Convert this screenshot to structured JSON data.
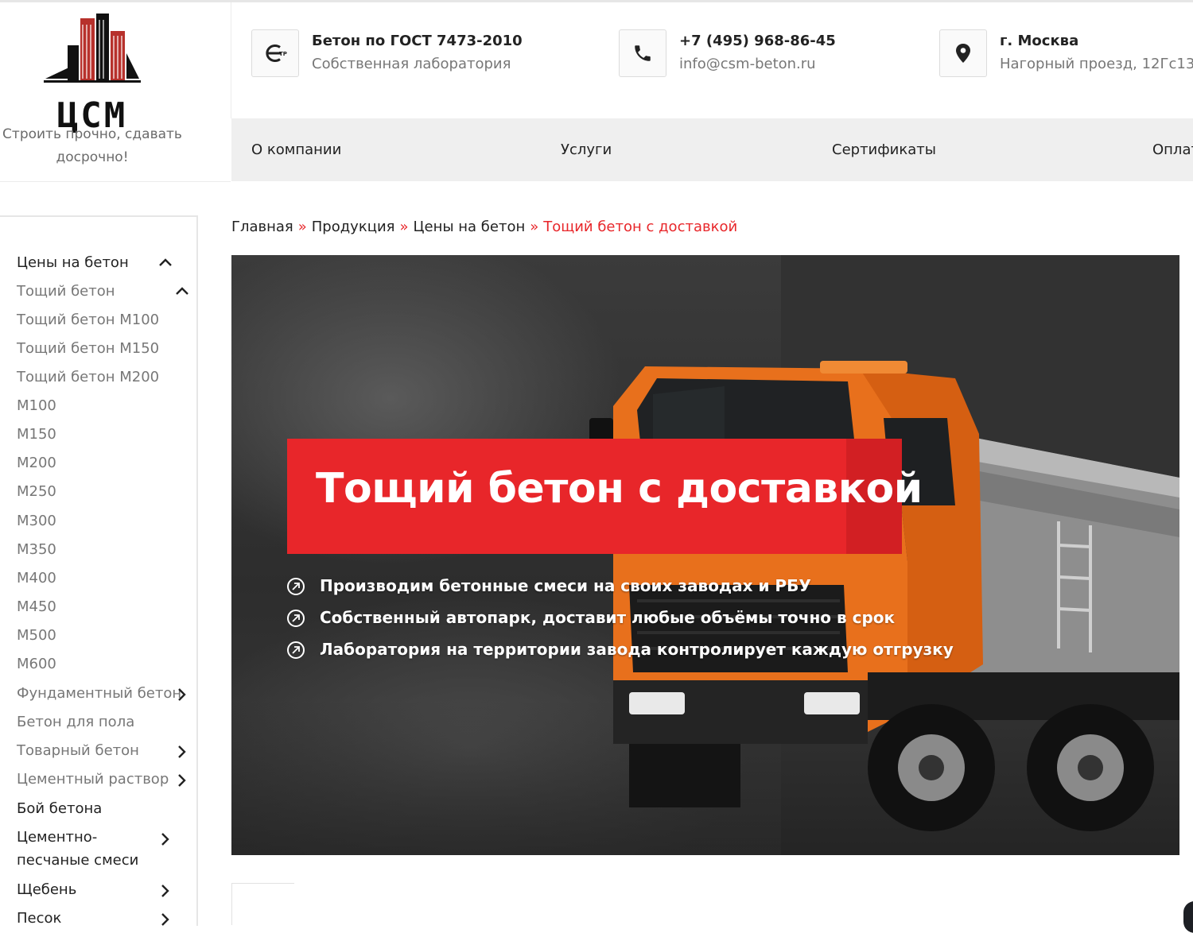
{
  "logo": {
    "text": "ЦСМ",
    "slogan_line1": "Строить прочно, сдавать",
    "slogan_line2": "досрочно!"
  },
  "header": {
    "info": [
      {
        "icon": "gost-certification-icon",
        "title": "Бетон по ГОСТ 7473-2010",
        "subtitle": "Собственная лаборатория"
      },
      {
        "icon": "phone-icon",
        "title": "+7 (495) 968-86-45",
        "subtitle": "info@csm-beton.ru"
      },
      {
        "icon": "location-pin-icon",
        "title": "г. Москва",
        "subtitle": "Нагорный проезд, 12Гс13"
      }
    ]
  },
  "nav": {
    "items": [
      "О компании",
      "Услуги",
      "Сертификаты",
      "Оплат"
    ]
  },
  "breadcrumb": {
    "items": [
      "Главная",
      "Продукция",
      "Цены на бетон"
    ],
    "separator": "»",
    "current": "Тощий бетон с доставкой"
  },
  "sidebar": {
    "items": [
      {
        "label": "Цены на бетон",
        "chevron": "up"
      },
      {
        "label": "Тощий бетон",
        "chevron": "up"
      },
      {
        "label": "Тощий бетон М100"
      },
      {
        "label": "Тощий бетон М150"
      },
      {
        "label": "Тощий бетон М200"
      },
      {
        "label": "М100"
      },
      {
        "label": "М150"
      },
      {
        "label": "М200"
      },
      {
        "label": "М250"
      },
      {
        "label": "М300"
      },
      {
        "label": "М350"
      },
      {
        "label": "М400"
      },
      {
        "label": "М450"
      },
      {
        "label": "М500"
      },
      {
        "label": "М600"
      },
      {
        "label": "Фундаментный бетон",
        "chevron": "right"
      },
      {
        "label": "Бетон для пола"
      },
      {
        "label": "Товарный бетон",
        "chevron": "right"
      },
      {
        "label": "Цементный раствор",
        "chevron": "right"
      },
      {
        "label": "Бой бетона"
      },
      {
        "label_line1": "Цементно-",
        "label_line2": "песчаные смеси",
        "chevron": "right"
      },
      {
        "label": "Щебень",
        "chevron": "right"
      },
      {
        "label": "Песок",
        "chevron": "right"
      }
    ]
  },
  "hero": {
    "title": "Тощий бетон с доставкой",
    "bullets": [
      "Производим бетонные смеси на своих заводах и РБУ",
      "Собственный автопарк, доставит любые объёмы точно в срок",
      "Лаборатория на территории завода контролирует каждую отгрузку"
    ]
  },
  "colors": {
    "accent": "#e8262a",
    "logo_red": "#b7312c",
    "text_dark": "#222222",
    "text_muted": "#777777",
    "nav_bg": "#efefef"
  }
}
